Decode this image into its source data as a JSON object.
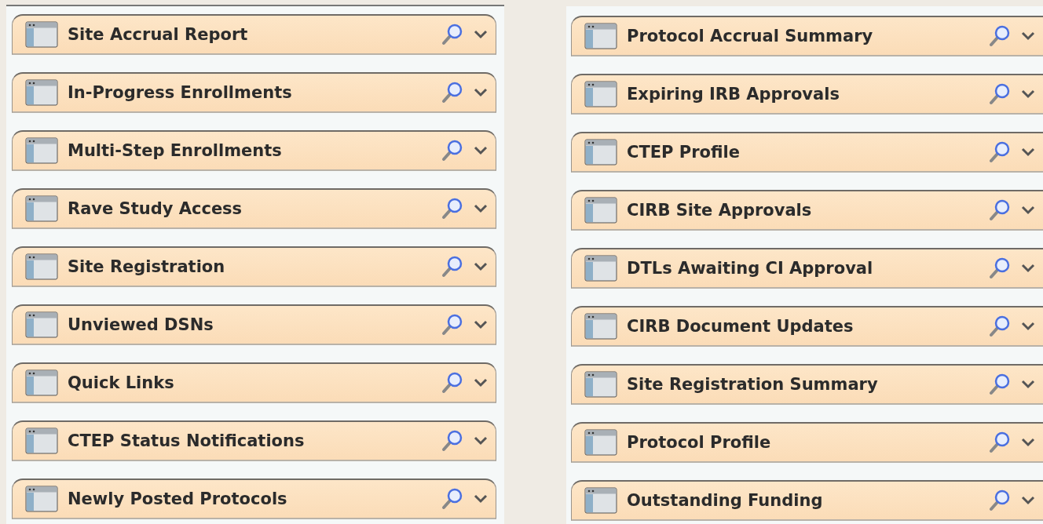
{
  "columns": [
    {
      "portlets": [
        {
          "title": "Site Accrual Report"
        },
        {
          "title": "In-Progress Enrollments"
        },
        {
          "title": "Multi-Step Enrollments"
        },
        {
          "title": "Rave Study Access"
        },
        {
          "title": "Site Registration"
        },
        {
          "title": "Unviewed DSNs"
        },
        {
          "title": "Quick Links"
        },
        {
          "title": "CTEP Status Notifications"
        },
        {
          "title": "Newly Posted Protocols"
        }
      ]
    },
    {
      "portlets": [
        {
          "title": "Protocol Accrual Summary"
        },
        {
          "title": "Expiring IRB Approvals"
        },
        {
          "title": "CTEP Profile"
        },
        {
          "title": "CIRB Site Approvals"
        },
        {
          "title": "DTLs Awaiting CI Approval"
        },
        {
          "title": "CIRB Document Updates"
        },
        {
          "title": "Site Registration Summary"
        },
        {
          "title": "Protocol Profile"
        },
        {
          "title": "Outstanding Funding"
        }
      ]
    }
  ]
}
